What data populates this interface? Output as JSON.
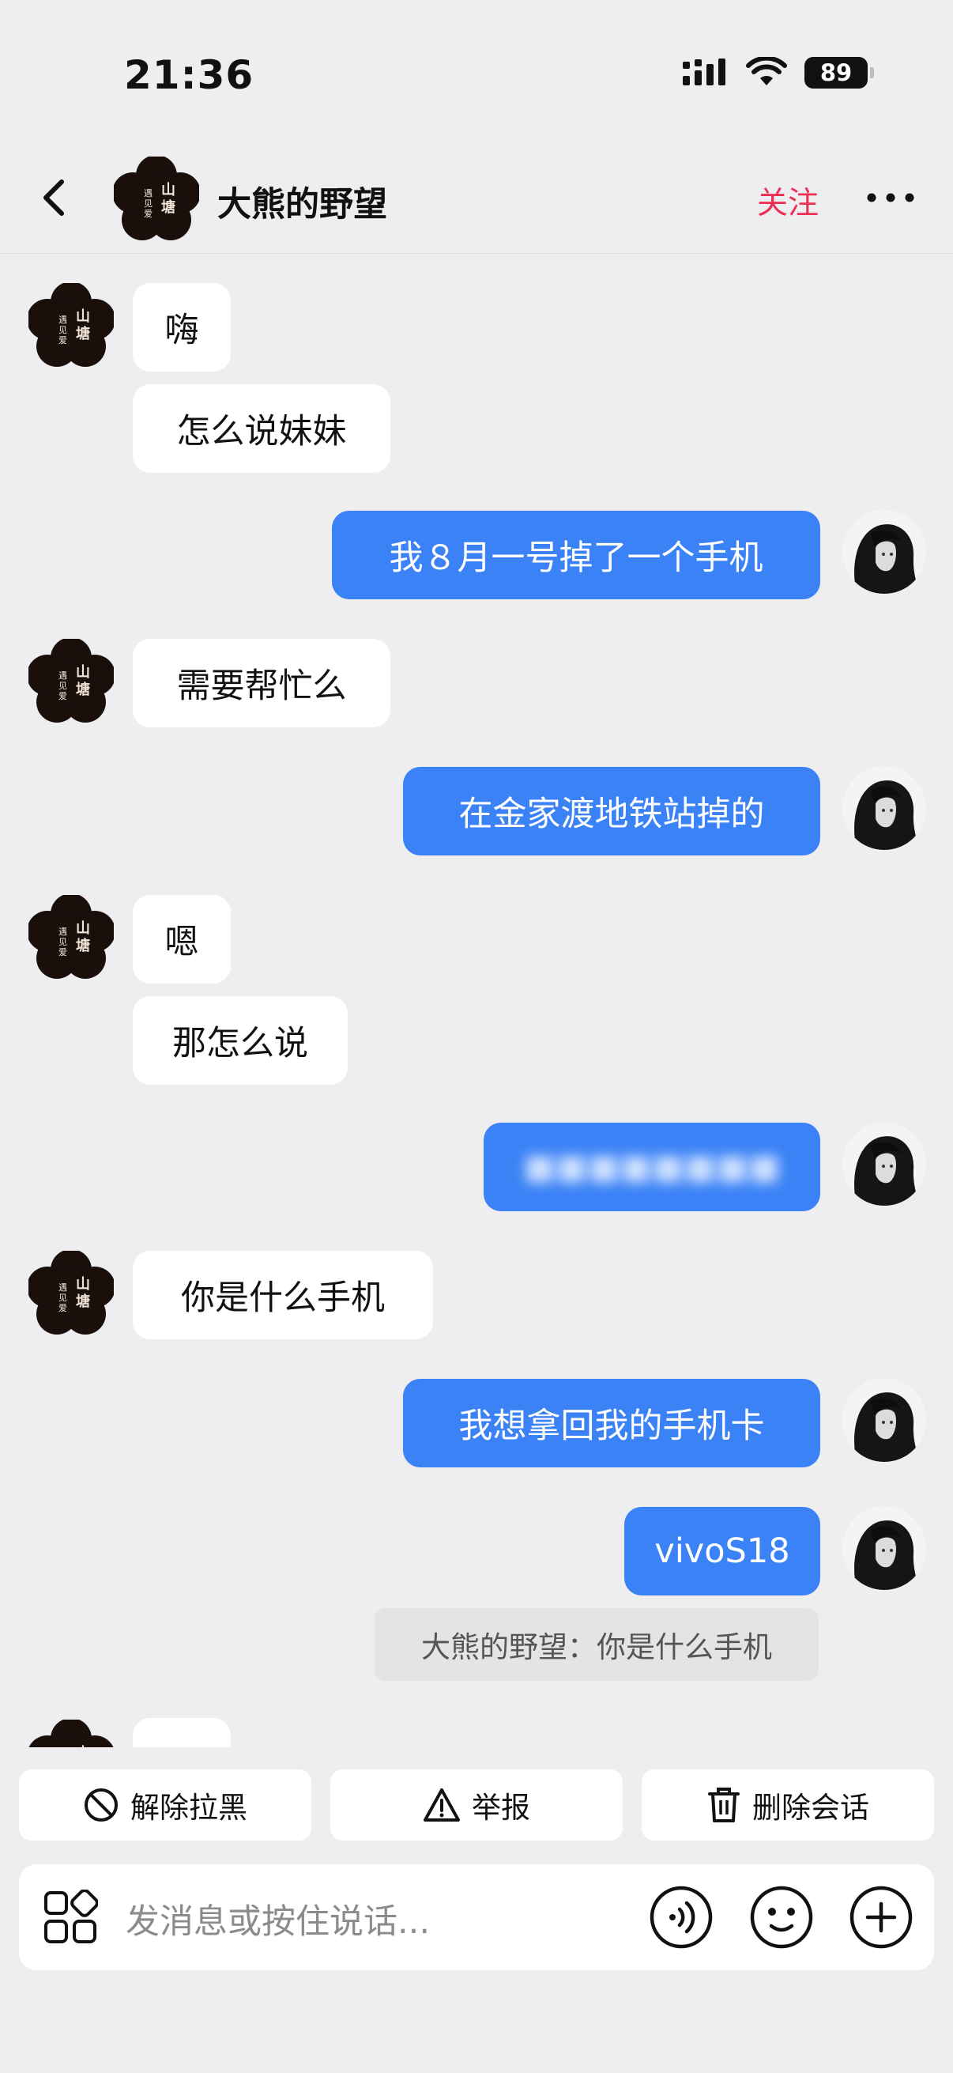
{
  "status_bar": {
    "time": "21:36",
    "battery": "89",
    "icons": [
      "signal-icon",
      "wifi-icon",
      "battery-icon"
    ]
  },
  "header": {
    "title": "大熊的野望",
    "follow_label": "关注",
    "avatar_text": "山塘遇见爱"
  },
  "messages": [
    {
      "side": "in",
      "text": "嗨"
    },
    {
      "side": "in",
      "text": "怎么说妹妹"
    },
    {
      "side": "out",
      "text": "我８月一号掉了一个手机"
    },
    {
      "side": "in",
      "text": "需要帮忙么"
    },
    {
      "side": "out",
      "text": "在金家渡地铁站掉的"
    },
    {
      "side": "in",
      "text": "嗯"
    },
    {
      "side": "in",
      "text": "那怎么说"
    },
    {
      "side": "out",
      "text": "",
      "blurred": true
    },
    {
      "side": "in",
      "text": "你是什么手机"
    },
    {
      "side": "out",
      "text": "我想拿回我的手机卡"
    },
    {
      "side": "out",
      "text": "vivoS18"
    }
  ],
  "quote": "大熊的野望：你是什么手机",
  "actions": {
    "unblock": "解除拉黑",
    "report": "举报",
    "delete": "删除会话"
  },
  "input": {
    "placeholder": "发消息或按住说话..."
  },
  "colors": {
    "accent": "#3b82f6",
    "follow": "#ee2f55",
    "background": "#eeeef1"
  }
}
